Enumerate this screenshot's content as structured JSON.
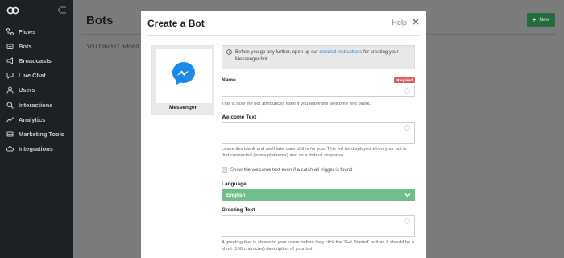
{
  "sidebar": {
    "items": [
      {
        "label": "Flows",
        "icon": "flows-icon"
      },
      {
        "label": "Bots",
        "icon": "bots-icon"
      },
      {
        "label": "Broadcasts",
        "icon": "broadcasts-icon"
      },
      {
        "label": "Live Chat",
        "icon": "chat-icon"
      },
      {
        "label": "Users",
        "icon": "user-icon"
      },
      {
        "label": "Interactions",
        "icon": "search-icon"
      },
      {
        "label": "Analytics",
        "icon": "analytics-icon"
      },
      {
        "label": "Marketing Tools",
        "icon": "megaphone-icon"
      },
      {
        "label": "Integrations",
        "icon": "cloud-icon"
      }
    ]
  },
  "page": {
    "title": "Bots",
    "empty_text": "You haven't added",
    "new_button": "New"
  },
  "modal": {
    "title": "Create a Bot",
    "help": "Help",
    "provider_label": "Messenger",
    "notice_before": "Before you go any further, open up our ",
    "notice_link": "detailed instructions",
    "notice_after": " for creating your Messenger bot.",
    "name_label": "Name",
    "required_badge": "Required",
    "name_help": "This is how the bot announces itself if you leave the welcome text blank.",
    "welcome_label": "Welcome Text",
    "welcome_help": "Leave this blank and we'll take care of this for you. This will be displayed when your bot is first connected (some platforms) and as a default response.",
    "checkbox_label": "Show the welcome text even if a catch-all trigger is found",
    "language_label": "Language",
    "language_value": "English",
    "greeting_label": "Greeting Text",
    "greeting_help": "A greeting that is shown to your users before they click the 'Get Started' button. It should be a short (160 character) description of your bot."
  },
  "colors": {
    "sidebar_bg": "#1d2124",
    "accent_green": "#6fbe8c",
    "new_button_bg": "#246b3e",
    "link_blue": "#2b8ec8",
    "required_red": "#e05d5d",
    "messenger_blue": "#1e88e5"
  }
}
